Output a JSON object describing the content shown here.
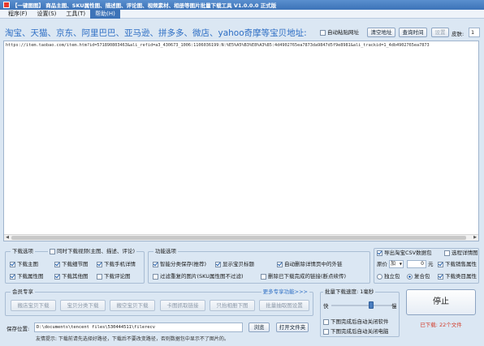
{
  "app": {
    "title": "【一键图图】 商品主图、SKU属性图、描述图、评论图、视频素材、相册等图片批量下载工具 V1.0.0.0 正式版"
  },
  "menu": [
    {
      "label": "程序(F)"
    },
    {
      "label": "设置(S)"
    },
    {
      "label": "工具(T)"
    },
    {
      "label": "帮助(H)"
    }
  ],
  "header": {
    "platforms_label": "淘宝、天猫、京东、阿里巴巴、亚马逊、拼多多、微店、yahoo奇摩等宝贝地址:",
    "auto_paste_label": "自动粘贴网址",
    "clear_button": "清空地址",
    "dedupe_button": "查询时间",
    "settings_button": "设置",
    "skin_label": "皮肤:",
    "skin_value": "1"
  },
  "urls": {
    "text": "https://item.taobao.com/item.htm?id=571890803463&ali_refid=a3_430673_1006:1106036199:N:%E5%A5%B3%E8%A3%85:4d4902765ea7873da9847d5f9e8981&ali_trackid=1_4db4902765ea7873"
  },
  "download_options": {
    "title": "下载选项",
    "video_label": "同时下载视频(主图、描述、评论)",
    "items": [
      {
        "label": "下载主图",
        "checked": true
      },
      {
        "label": "下载细节图",
        "checked": true
      },
      {
        "label": "下载手机详情",
        "checked": true
      },
      {
        "label": "下载属性图",
        "checked": true
      },
      {
        "label": "下载其他图",
        "checked": true
      },
      {
        "label": "下载评论图",
        "checked": false
      }
    ]
  },
  "function_options": {
    "title": "功能选项",
    "items": [
      {
        "label": "智能分类保存(推荐)",
        "checked": true
      },
      {
        "label": "显示宝贝标题",
        "checked": true
      },
      {
        "label": "自动删除详情页中的外链",
        "checked": true
      },
      {
        "label": "过滤重复的图片(SKU属性图不过滤)",
        "checked": false
      },
      {
        "label": "删除已下载完成的链接(断点续传)",
        "checked": false
      }
    ]
  },
  "right_options": {
    "export_csv": "导出淘宝CSV数据包",
    "export_csv_checked": true,
    "detail_page": "选程详情图",
    "price_label": "原价",
    "price_op": "加",
    "price_value": "0",
    "price_unit": "元",
    "download_sales": "下载销售属性",
    "download_sales_checked": true,
    "radio_single": "独立包",
    "radio_combined": "复合包",
    "download_category": "下载类目属性",
    "download_category_checked": true
  },
  "member": {
    "title": "会员专享",
    "more_link": "更多专享功能>>>",
    "buttons": [
      {
        "label": "搬店宝贝下载"
      },
      {
        "label": "宝贝分类下载"
      },
      {
        "label": "搬空宝贝下载"
      },
      {
        "label": "卡图抓取链接"
      },
      {
        "label": "只抬相册下图"
      },
      {
        "label": "批量抽取图设置"
      }
    ]
  },
  "speed": {
    "title": "批量下载速度: 1毫秒",
    "slow": "快",
    "fast": "慢",
    "level": 0.68,
    "close_software": "下图完成后自动关闭软件",
    "close_computer": "下图完成后自动关闭电脑"
  },
  "save": {
    "label": "保存位置:",
    "path": "D:\\documents\\tencent files\\530444511\\filerecv",
    "browse_button": "浏览",
    "open_button": "打开文件夹"
  },
  "hint": {
    "text": "友情提示: 下载前请先选择好路径，下载后不要改变路径，否则数据包中显示不了图片的。"
  },
  "stop": {
    "label": "停止",
    "count": "已下载: 22个文件"
  }
}
